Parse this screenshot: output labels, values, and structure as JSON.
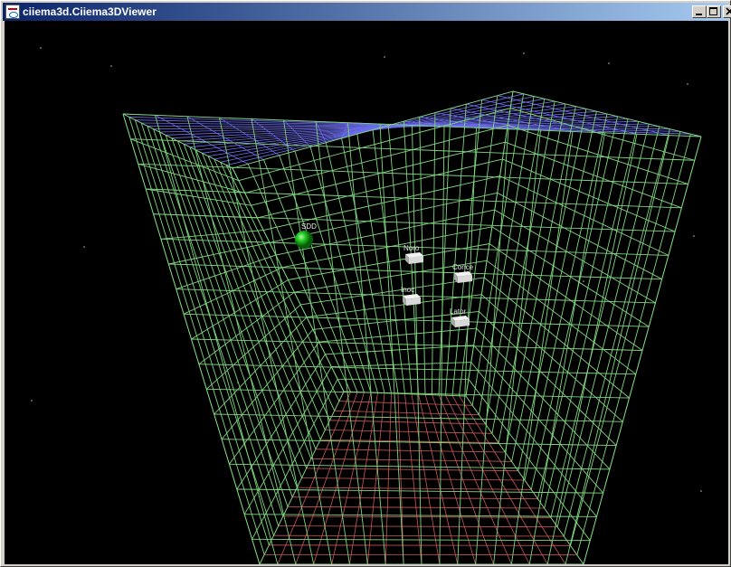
{
  "window": {
    "title": "ciiema3d.Ciiema3DViewer"
  },
  "title_buttons": {
    "minimize": "minimize",
    "maximize": "maximize",
    "close": "close"
  },
  "icons": {
    "app": "java-cup-icon",
    "minimize": "minimize-icon",
    "maximize": "maximize-icon",
    "close": "close-icon"
  },
  "scene": {
    "colors": {
      "background": "#000000",
      "grid_walls": "#7fd67f",
      "grid_top": "#6d6df0",
      "grid_floor": "#c95858",
      "sphere": "#22cc22",
      "box": "#d9d9d9"
    },
    "objects": [
      {
        "label": "SDD",
        "shape": "sphere"
      },
      {
        "label": "Noro",
        "shape": "box"
      },
      {
        "label": "Conce",
        "shape": "box"
      },
      {
        "label": "Inoc",
        "shape": "box"
      },
      {
        "label": "Lator",
        "shape": "box"
      }
    ]
  }
}
